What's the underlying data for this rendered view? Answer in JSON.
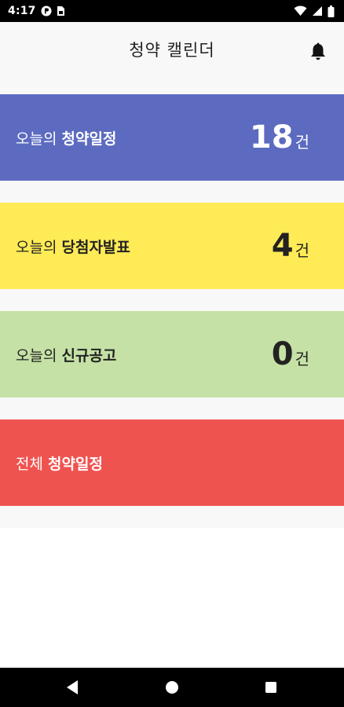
{
  "status_bar": {
    "time": "4:17",
    "icons": [
      "pocket-icon",
      "sim-card-icon",
      "wifi-icon",
      "signal-icon",
      "battery-icon"
    ]
  },
  "app_bar": {
    "title": "청약 캘린더",
    "action_icon": "bell-icon"
  },
  "cards": [
    {
      "prefix": "오늘의 ",
      "title": "청약일정",
      "count": "18",
      "unit": "건",
      "color": "#5c6bc0",
      "text_color": "#ffffff"
    },
    {
      "prefix": "오늘의 ",
      "title": "당첨자발표",
      "count": "4",
      "unit": "건",
      "color": "#ffeb56",
      "text_color": "#222222"
    },
    {
      "prefix": "오늘의 ",
      "title": "신규공고",
      "count": "0",
      "unit": "건",
      "color": "#c5e1a5",
      "text_color": "#222222"
    },
    {
      "prefix": "전체 ",
      "title": "청약일정",
      "color": "#ef5350",
      "text_color": "#ffffff"
    }
  ],
  "nav_bar": {
    "icons": [
      "back-icon",
      "home-icon",
      "recent-apps-icon"
    ]
  }
}
